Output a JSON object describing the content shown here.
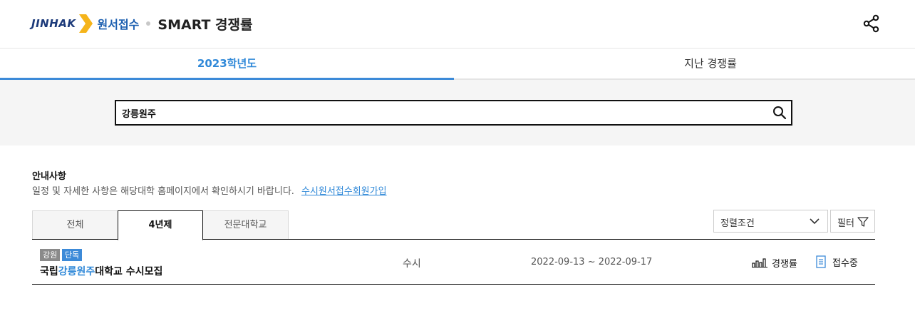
{
  "header": {
    "logo_text": "JINHAK",
    "service_name": "원서접수",
    "app_title": "SMART 경쟁률",
    "share_icon": "share-icon"
  },
  "year_tabs": [
    {
      "label": "2023학년도",
      "active": true
    },
    {
      "label": "지난 경쟁률",
      "active": false
    }
  ],
  "search": {
    "value": "강릉원주",
    "icon": "search-icon"
  },
  "notice": {
    "title": "안내사항",
    "text": "일정 및 자세한 사항은 해당대학 홈페이지에서 확인하시기 바랍니다.",
    "link": "수시원서접수회원가입"
  },
  "category_tabs": [
    {
      "label": "전체",
      "active": false
    },
    {
      "label": "4년제",
      "active": true
    },
    {
      "label": "전문대학교",
      "active": false
    }
  ],
  "sort": {
    "label": "정렬조건"
  },
  "filter": {
    "label": "필터"
  },
  "results": [
    {
      "badges": [
        "강원",
        "단독"
      ],
      "name_prefix": "국립",
      "name_highlight": "강릉원주",
      "name_suffix": "대학교 수시모집",
      "type": "수시",
      "period": "2022-09-13 ~ 2022-09-17",
      "rate_label": "경쟁률",
      "status_label": "접수중"
    }
  ],
  "colors": {
    "accent": "#2f88d8",
    "badge_region": "#8a8a8a",
    "badge_single": "#3c8ad8",
    "logo_yellow": "#f5b41a",
    "logo_navy": "#1c3a7a"
  }
}
